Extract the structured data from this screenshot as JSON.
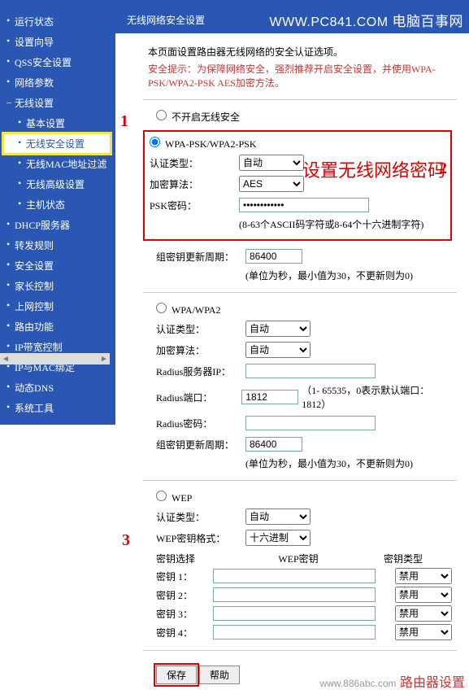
{
  "watermark": {
    "url": "WWW.PC841.COM",
    "brand": "电脑百事网"
  },
  "footer_watermark": "路由器设置",
  "markers": {
    "m1": "1",
    "m2": "2",
    "m3": "3"
  },
  "sidebar": {
    "items": [
      "运行状态",
      "设置向导",
      "QSS安全设置",
      "网络参数",
      "无线设置",
      "基本设置",
      "无线安全设置",
      "无线MAC地址过滤",
      "无线高级设置",
      "主机状态",
      "DHCP服务器",
      "转发规则",
      "安全设置",
      "家长控制",
      "上网控制",
      "路由功能",
      "IP带宽控制",
      "IP与MAC绑定",
      "动态DNS",
      "系统工具"
    ]
  },
  "page": {
    "title": "无线网络安全设置",
    "desc": "本页面设置路由器无线网络的安全认证选项。",
    "tip_label": "安全提示：",
    "tip_text": "为保障网络安全，强烈推荐开启安全设置，并使用WPA-PSK/WPA2-PSK AES加密方法。",
    "opt_none": "不开启无线安全",
    "opt_wpapsk": "WPA-PSK/WPA2-PSK",
    "opt_wpa": "WPA/WPA2",
    "opt_wep": "WEP",
    "lbl_auth": "认证类型：",
    "lbl_enc": "加密算法：",
    "lbl_psk": "PSK密码：",
    "lbl_radius_ip": "Radius服务器IP：",
    "lbl_radius_port": "Radius端口：",
    "lbl_radius_pwd": "Radius密码：",
    "lbl_rekey": "组密钥更新周期：",
    "lbl_wep_auth": "认证类型：",
    "lbl_wep_fmt": "WEP密钥格式：",
    "lbl_key_select": "密钥选择",
    "lbl_wep_key": "WEP密钥",
    "lbl_key_type": "密钥类型",
    "key1": "密钥 1：",
    "key2": "密钥 2：",
    "key3": "密钥 3：",
    "key4": "密钥 4：",
    "auto": "自动",
    "aes": "AES",
    "hex": "十六进制",
    "disable": "禁用",
    "psk_hint": "(8-63个ASCII码字符或8-64个十六进制字符)",
    "rekey_hint": "(单位为秒，最小值为30，不更新则为0)",
    "port_hint": "（1- 65535，0表示默认端口：1812）",
    "rekey_val": "86400",
    "rekey_val2": "86400",
    "port_val": "1812",
    "overlay_text": "设置无线网络密码",
    "btn_save": "保存",
    "btn_help": "帮助"
  }
}
